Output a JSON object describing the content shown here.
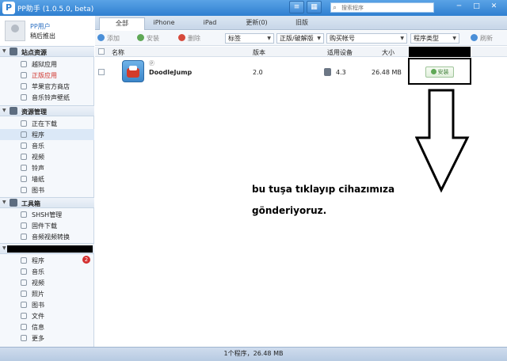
{
  "window": {
    "title": "PP助手 (1.0.5.0, beta)",
    "search_placeholder": "搜索程序",
    "controls": [
      "─",
      "□",
      "✕"
    ]
  },
  "user": {
    "name": "PP用户",
    "logout": "稍后推出"
  },
  "sidebar": {
    "sections": [
      {
        "label": "站点资源",
        "items": [
          "越狱应用",
          "正版应用",
          "苹果官方商店",
          "音乐铃声壁纸"
        ]
      },
      {
        "label": "资源管理",
        "items": [
          "正在下载",
          "程序",
          "音乐",
          "视频",
          "铃声",
          "墙纸",
          "图书"
        ]
      },
      {
        "label": "工具箱",
        "items": [
          "SHSH管理",
          "固件下载",
          "音频视频转换"
        ]
      },
      {
        "label": "",
        "items": [
          "程序",
          "音乐",
          "视频",
          "照片",
          "图书",
          "文件",
          "信息",
          "更多"
        ]
      }
    ],
    "badge": "2"
  },
  "tabs": [
    "全部",
    "iPhone",
    "iPad",
    "更新(0)",
    "旧版"
  ],
  "toolbar": {
    "add": "添加",
    "install": "安装",
    "delete": "删除",
    "filters": [
      "标签",
      "正版/破解版",
      "购买帐号",
      "程序类型"
    ],
    "refresh": "刷新"
  },
  "table": {
    "headers": {
      "name": "名称",
      "version": "版本",
      "device": "适用设备",
      "size": "大小"
    },
    "rows": [
      {
        "name": "DoodleJump",
        "version": "2.0",
        "device": "4.3",
        "size": "26.48 MB",
        "action": "安装"
      }
    ]
  },
  "annotation": {
    "line1": "bu tuşa tıklayıp cihazımıza",
    "line2": "gönderiyoruz."
  },
  "status": "1个程序，26.48 MB"
}
